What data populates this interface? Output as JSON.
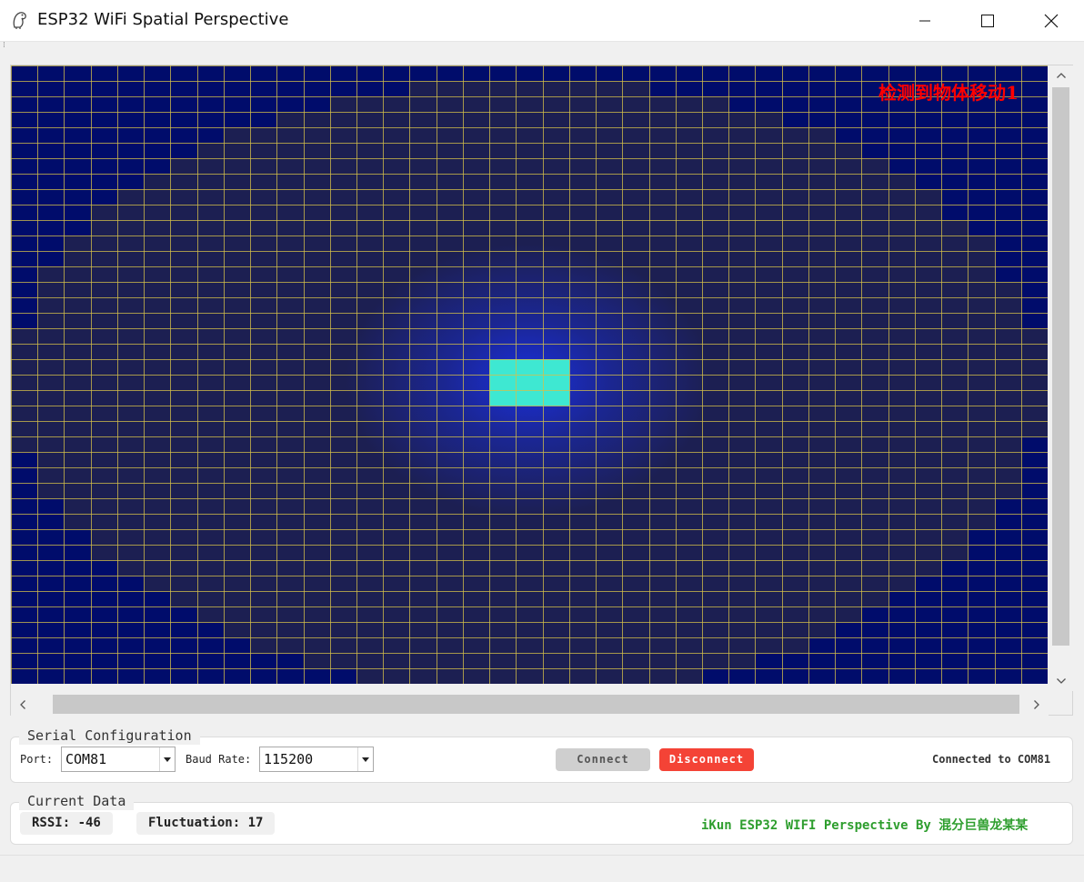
{
  "window": {
    "title": "ESP32 WiFi Spatial Perspective",
    "icon": "app-logo-icon"
  },
  "heatmap": {
    "alert_text": "检测到物体移动1",
    "colors": {
      "background": "#000c6b",
      "ellipse_fill": "#1c1f52",
      "grid_line": "#d4c04a",
      "hotspot": "#3ee8d2",
      "glow": "#1a2fe0",
      "alert": "#ff0000"
    }
  },
  "serial": {
    "group_title": "Serial Configuration",
    "port_label": "Port:",
    "port_value": "COM81",
    "baud_label": "Baud Rate:",
    "baud_value": "115200",
    "connect_label": "Connect",
    "disconnect_label": "Disconnect",
    "status_text": "Connected to COM81"
  },
  "current": {
    "group_title": "Current Data",
    "rssi_text": "RSSI: -46",
    "fluctuation_text": "Fluctuation: 17",
    "credit_text": "iKun ESP32 WIFI Perspective By 混分巨兽龙某某"
  },
  "colors": {
    "disconnect": "#f44336",
    "connect_disabled": "#cfcfcf",
    "credit": "#2e9e2e"
  }
}
